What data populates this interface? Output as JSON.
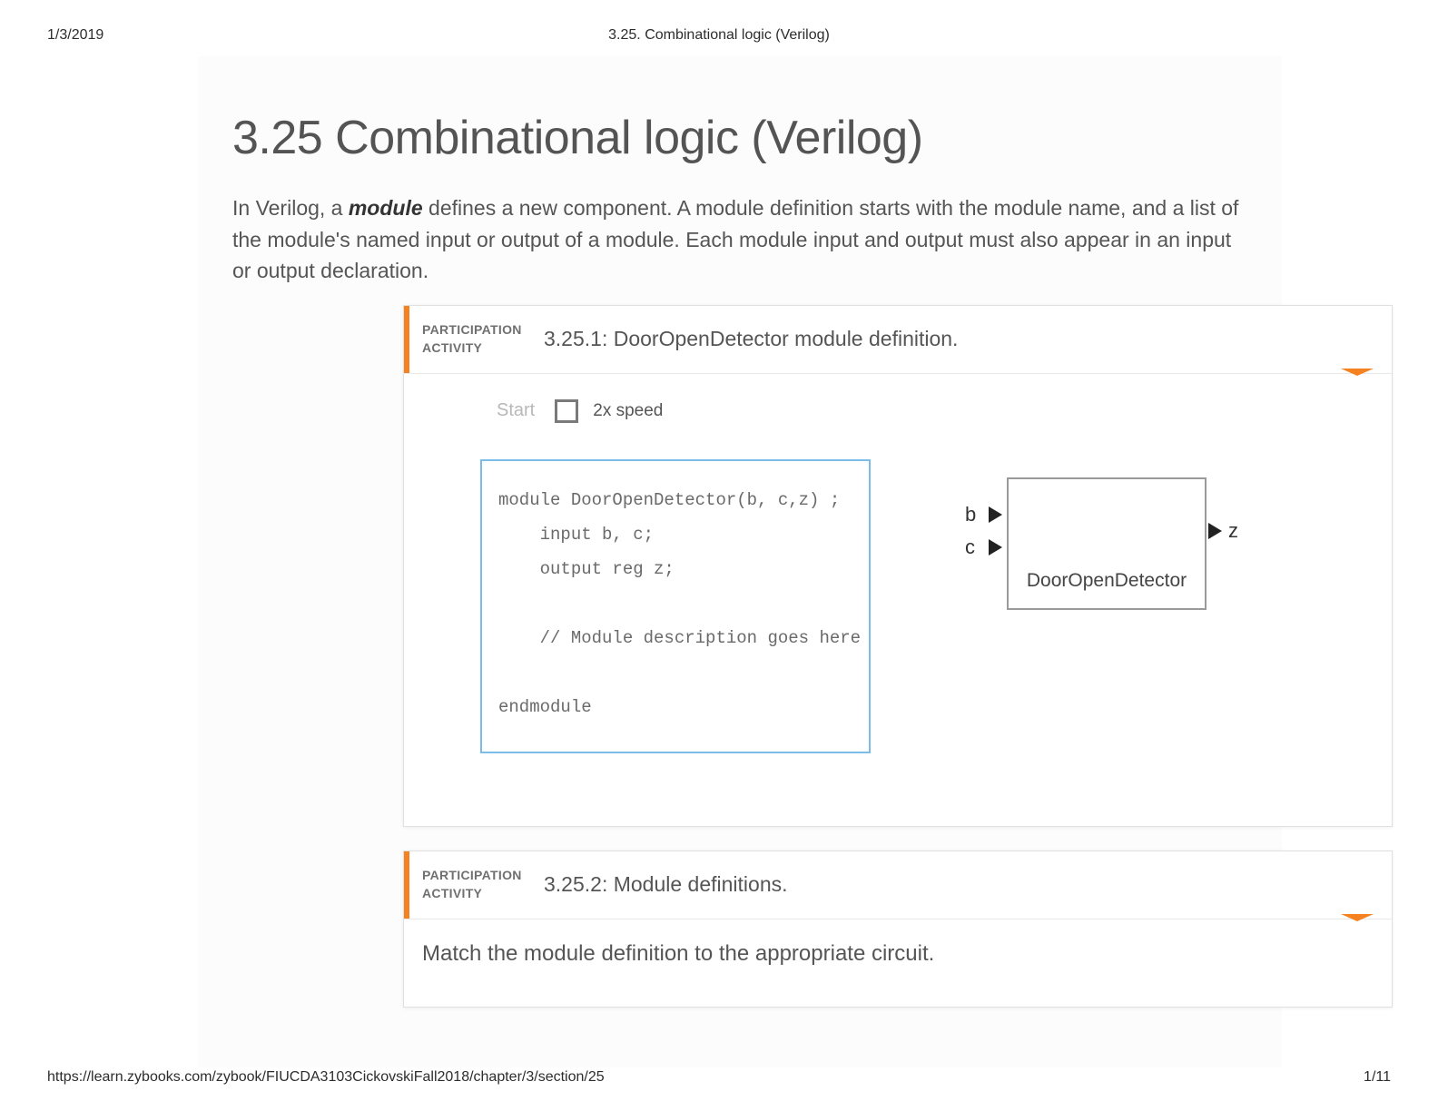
{
  "print": {
    "date": "1/3/2019",
    "title": "3.25. Combinational logic (Verilog)",
    "url": "https://learn.zybooks.com/zybook/FIUCDA3103CickovskiFall2018/chapter/3/section/25",
    "page": "1/11"
  },
  "page_title": "3.25 Combinational logic (Verilog)",
  "intro_before": "In Verilog, a ",
  "intro_keyword": "module",
  "intro_after": " defines a new component. A module definition starts with the module name, and a list of the module's named input or output of a module. Each module input and output must also appear in an input or output declaration.",
  "activity1": {
    "tag_line1": "PARTICIPATION",
    "tag_line2": "ACTIVITY",
    "title": "3.25.1: DoorOpenDetector module definition.",
    "start_label": "Start",
    "speed_label": "2x speed",
    "code": "module DoorOpenDetector(b, c,z) ;\n    input b, c;\n    output reg z;\n\n    // Module description goes here\n\nendmodule",
    "diagram": {
      "input_b": "b",
      "input_c": "c",
      "output_z": "z",
      "box_label": "DoorOpenDetector"
    }
  },
  "activity2": {
    "tag_line1": "PARTICIPATION",
    "tag_line2": "ACTIVITY",
    "title": "3.25.2: Module definitions.",
    "prompt": "Match the module definition to the appropriate circuit."
  }
}
